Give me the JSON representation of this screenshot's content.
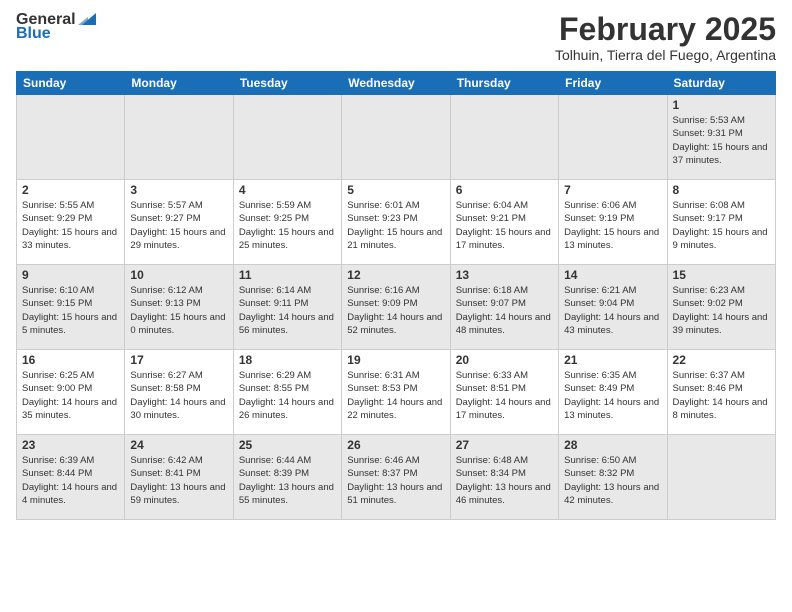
{
  "logo": {
    "general": "General",
    "blue": "Blue"
  },
  "header": {
    "title": "February 2025",
    "subtitle": "Tolhuin, Tierra del Fuego, Argentina"
  },
  "days_of_week": [
    "Sunday",
    "Monday",
    "Tuesday",
    "Wednesday",
    "Thursday",
    "Friday",
    "Saturday"
  ],
  "weeks": [
    [
      {
        "day": "",
        "info": ""
      },
      {
        "day": "",
        "info": ""
      },
      {
        "day": "",
        "info": ""
      },
      {
        "day": "",
        "info": ""
      },
      {
        "day": "",
        "info": ""
      },
      {
        "day": "",
        "info": ""
      },
      {
        "day": "1",
        "info": "Sunrise: 5:53 AM\nSunset: 9:31 PM\nDaylight: 15 hours and 37 minutes."
      }
    ],
    [
      {
        "day": "2",
        "info": "Sunrise: 5:55 AM\nSunset: 9:29 PM\nDaylight: 15 hours and 33 minutes."
      },
      {
        "day": "3",
        "info": "Sunrise: 5:57 AM\nSunset: 9:27 PM\nDaylight: 15 hours and 29 minutes."
      },
      {
        "day": "4",
        "info": "Sunrise: 5:59 AM\nSunset: 9:25 PM\nDaylight: 15 hours and 25 minutes."
      },
      {
        "day": "5",
        "info": "Sunrise: 6:01 AM\nSunset: 9:23 PM\nDaylight: 15 hours and 21 minutes."
      },
      {
        "day": "6",
        "info": "Sunrise: 6:04 AM\nSunset: 9:21 PM\nDaylight: 15 hours and 17 minutes."
      },
      {
        "day": "7",
        "info": "Sunrise: 6:06 AM\nSunset: 9:19 PM\nDaylight: 15 hours and 13 minutes."
      },
      {
        "day": "8",
        "info": "Sunrise: 6:08 AM\nSunset: 9:17 PM\nDaylight: 15 hours and 9 minutes."
      }
    ],
    [
      {
        "day": "9",
        "info": "Sunrise: 6:10 AM\nSunset: 9:15 PM\nDaylight: 15 hours and 5 minutes."
      },
      {
        "day": "10",
        "info": "Sunrise: 6:12 AM\nSunset: 9:13 PM\nDaylight: 15 hours and 0 minutes."
      },
      {
        "day": "11",
        "info": "Sunrise: 6:14 AM\nSunset: 9:11 PM\nDaylight: 14 hours and 56 minutes."
      },
      {
        "day": "12",
        "info": "Sunrise: 6:16 AM\nSunset: 9:09 PM\nDaylight: 14 hours and 52 minutes."
      },
      {
        "day": "13",
        "info": "Sunrise: 6:18 AM\nSunset: 9:07 PM\nDaylight: 14 hours and 48 minutes."
      },
      {
        "day": "14",
        "info": "Sunrise: 6:21 AM\nSunset: 9:04 PM\nDaylight: 14 hours and 43 minutes."
      },
      {
        "day": "15",
        "info": "Sunrise: 6:23 AM\nSunset: 9:02 PM\nDaylight: 14 hours and 39 minutes."
      }
    ],
    [
      {
        "day": "16",
        "info": "Sunrise: 6:25 AM\nSunset: 9:00 PM\nDaylight: 14 hours and 35 minutes."
      },
      {
        "day": "17",
        "info": "Sunrise: 6:27 AM\nSunset: 8:58 PM\nDaylight: 14 hours and 30 minutes."
      },
      {
        "day": "18",
        "info": "Sunrise: 6:29 AM\nSunset: 8:55 PM\nDaylight: 14 hours and 26 minutes."
      },
      {
        "day": "19",
        "info": "Sunrise: 6:31 AM\nSunset: 8:53 PM\nDaylight: 14 hours and 22 minutes."
      },
      {
        "day": "20",
        "info": "Sunrise: 6:33 AM\nSunset: 8:51 PM\nDaylight: 14 hours and 17 minutes."
      },
      {
        "day": "21",
        "info": "Sunrise: 6:35 AM\nSunset: 8:49 PM\nDaylight: 14 hours and 13 minutes."
      },
      {
        "day": "22",
        "info": "Sunrise: 6:37 AM\nSunset: 8:46 PM\nDaylight: 14 hours and 8 minutes."
      }
    ],
    [
      {
        "day": "23",
        "info": "Sunrise: 6:39 AM\nSunset: 8:44 PM\nDaylight: 14 hours and 4 minutes."
      },
      {
        "day": "24",
        "info": "Sunrise: 6:42 AM\nSunset: 8:41 PM\nDaylight: 13 hours and 59 minutes."
      },
      {
        "day": "25",
        "info": "Sunrise: 6:44 AM\nSunset: 8:39 PM\nDaylight: 13 hours and 55 minutes."
      },
      {
        "day": "26",
        "info": "Sunrise: 6:46 AM\nSunset: 8:37 PM\nDaylight: 13 hours and 51 minutes."
      },
      {
        "day": "27",
        "info": "Sunrise: 6:48 AM\nSunset: 8:34 PM\nDaylight: 13 hours and 46 minutes."
      },
      {
        "day": "28",
        "info": "Sunrise: 6:50 AM\nSunset: 8:32 PM\nDaylight: 13 hours and 42 minutes."
      },
      {
        "day": "",
        "info": ""
      }
    ]
  ]
}
